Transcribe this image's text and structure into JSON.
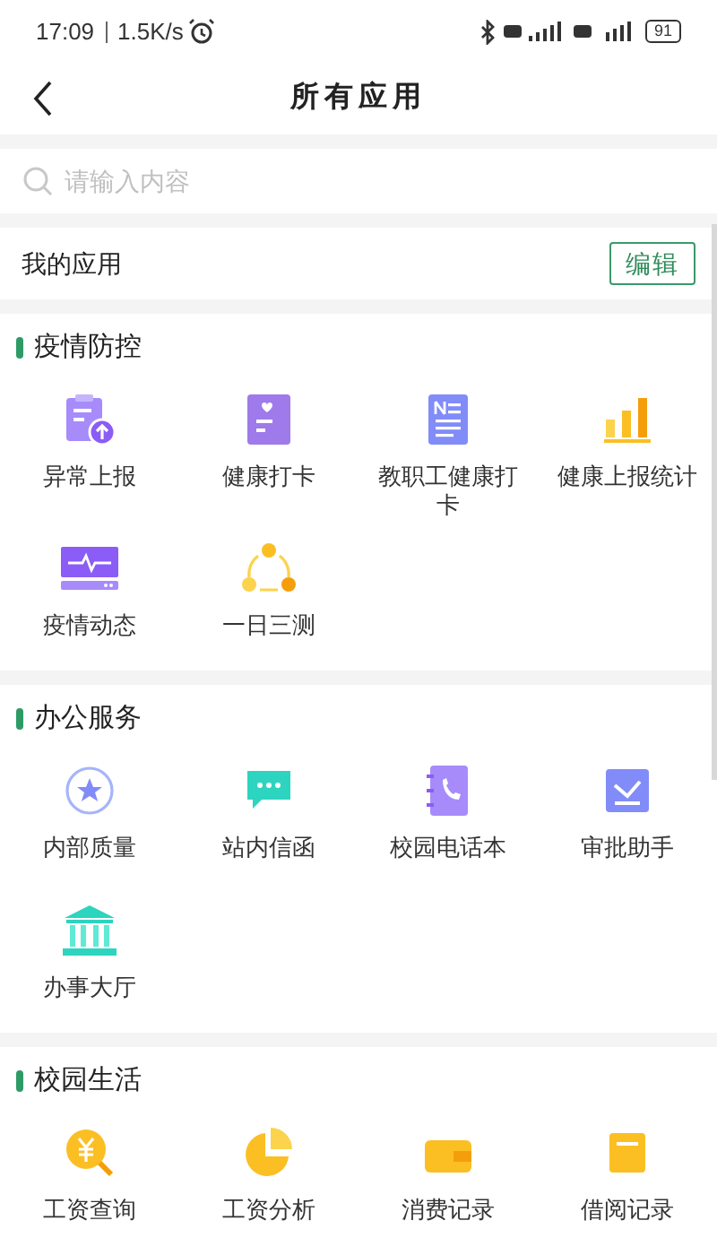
{
  "status_bar": {
    "time": "17:09",
    "speed": "1.5K/s",
    "battery": "91"
  },
  "header": {
    "title": "所有应用"
  },
  "search": {
    "placeholder": "请输入内容"
  },
  "my_apps": {
    "label": "我的应用",
    "button": "编辑"
  },
  "sections": [
    {
      "title": "疫情防控",
      "items": [
        {
          "label": "异常上报",
          "kind": "clipboard"
        },
        {
          "label": "健康打卡",
          "kind": "heartcard"
        },
        {
          "label": "教职工健康打卡",
          "kind": "document"
        },
        {
          "label": "健康上报统计",
          "kind": "bars"
        },
        {
          "label": "疫情动态",
          "kind": "monitor"
        },
        {
          "label": "一日三测",
          "kind": "cycle"
        }
      ]
    },
    {
      "title": "办公服务",
      "items": [
        {
          "label": "内部质量",
          "kind": "star"
        },
        {
          "label": "站内信函",
          "kind": "chat"
        },
        {
          "label": "校园电话本",
          "kind": "phonebook"
        },
        {
          "label": "审批助手",
          "kind": "check"
        },
        {
          "label": "办事大厅",
          "kind": "hall"
        }
      ]
    },
    {
      "title": "校园生活",
      "items": [
        {
          "label": "工资查询",
          "kind": "yen"
        },
        {
          "label": "工资分析",
          "kind": "pie"
        },
        {
          "label": "消费记录",
          "kind": "wallet"
        },
        {
          "label": "借阅记录",
          "kind": "book"
        }
      ]
    }
  ]
}
